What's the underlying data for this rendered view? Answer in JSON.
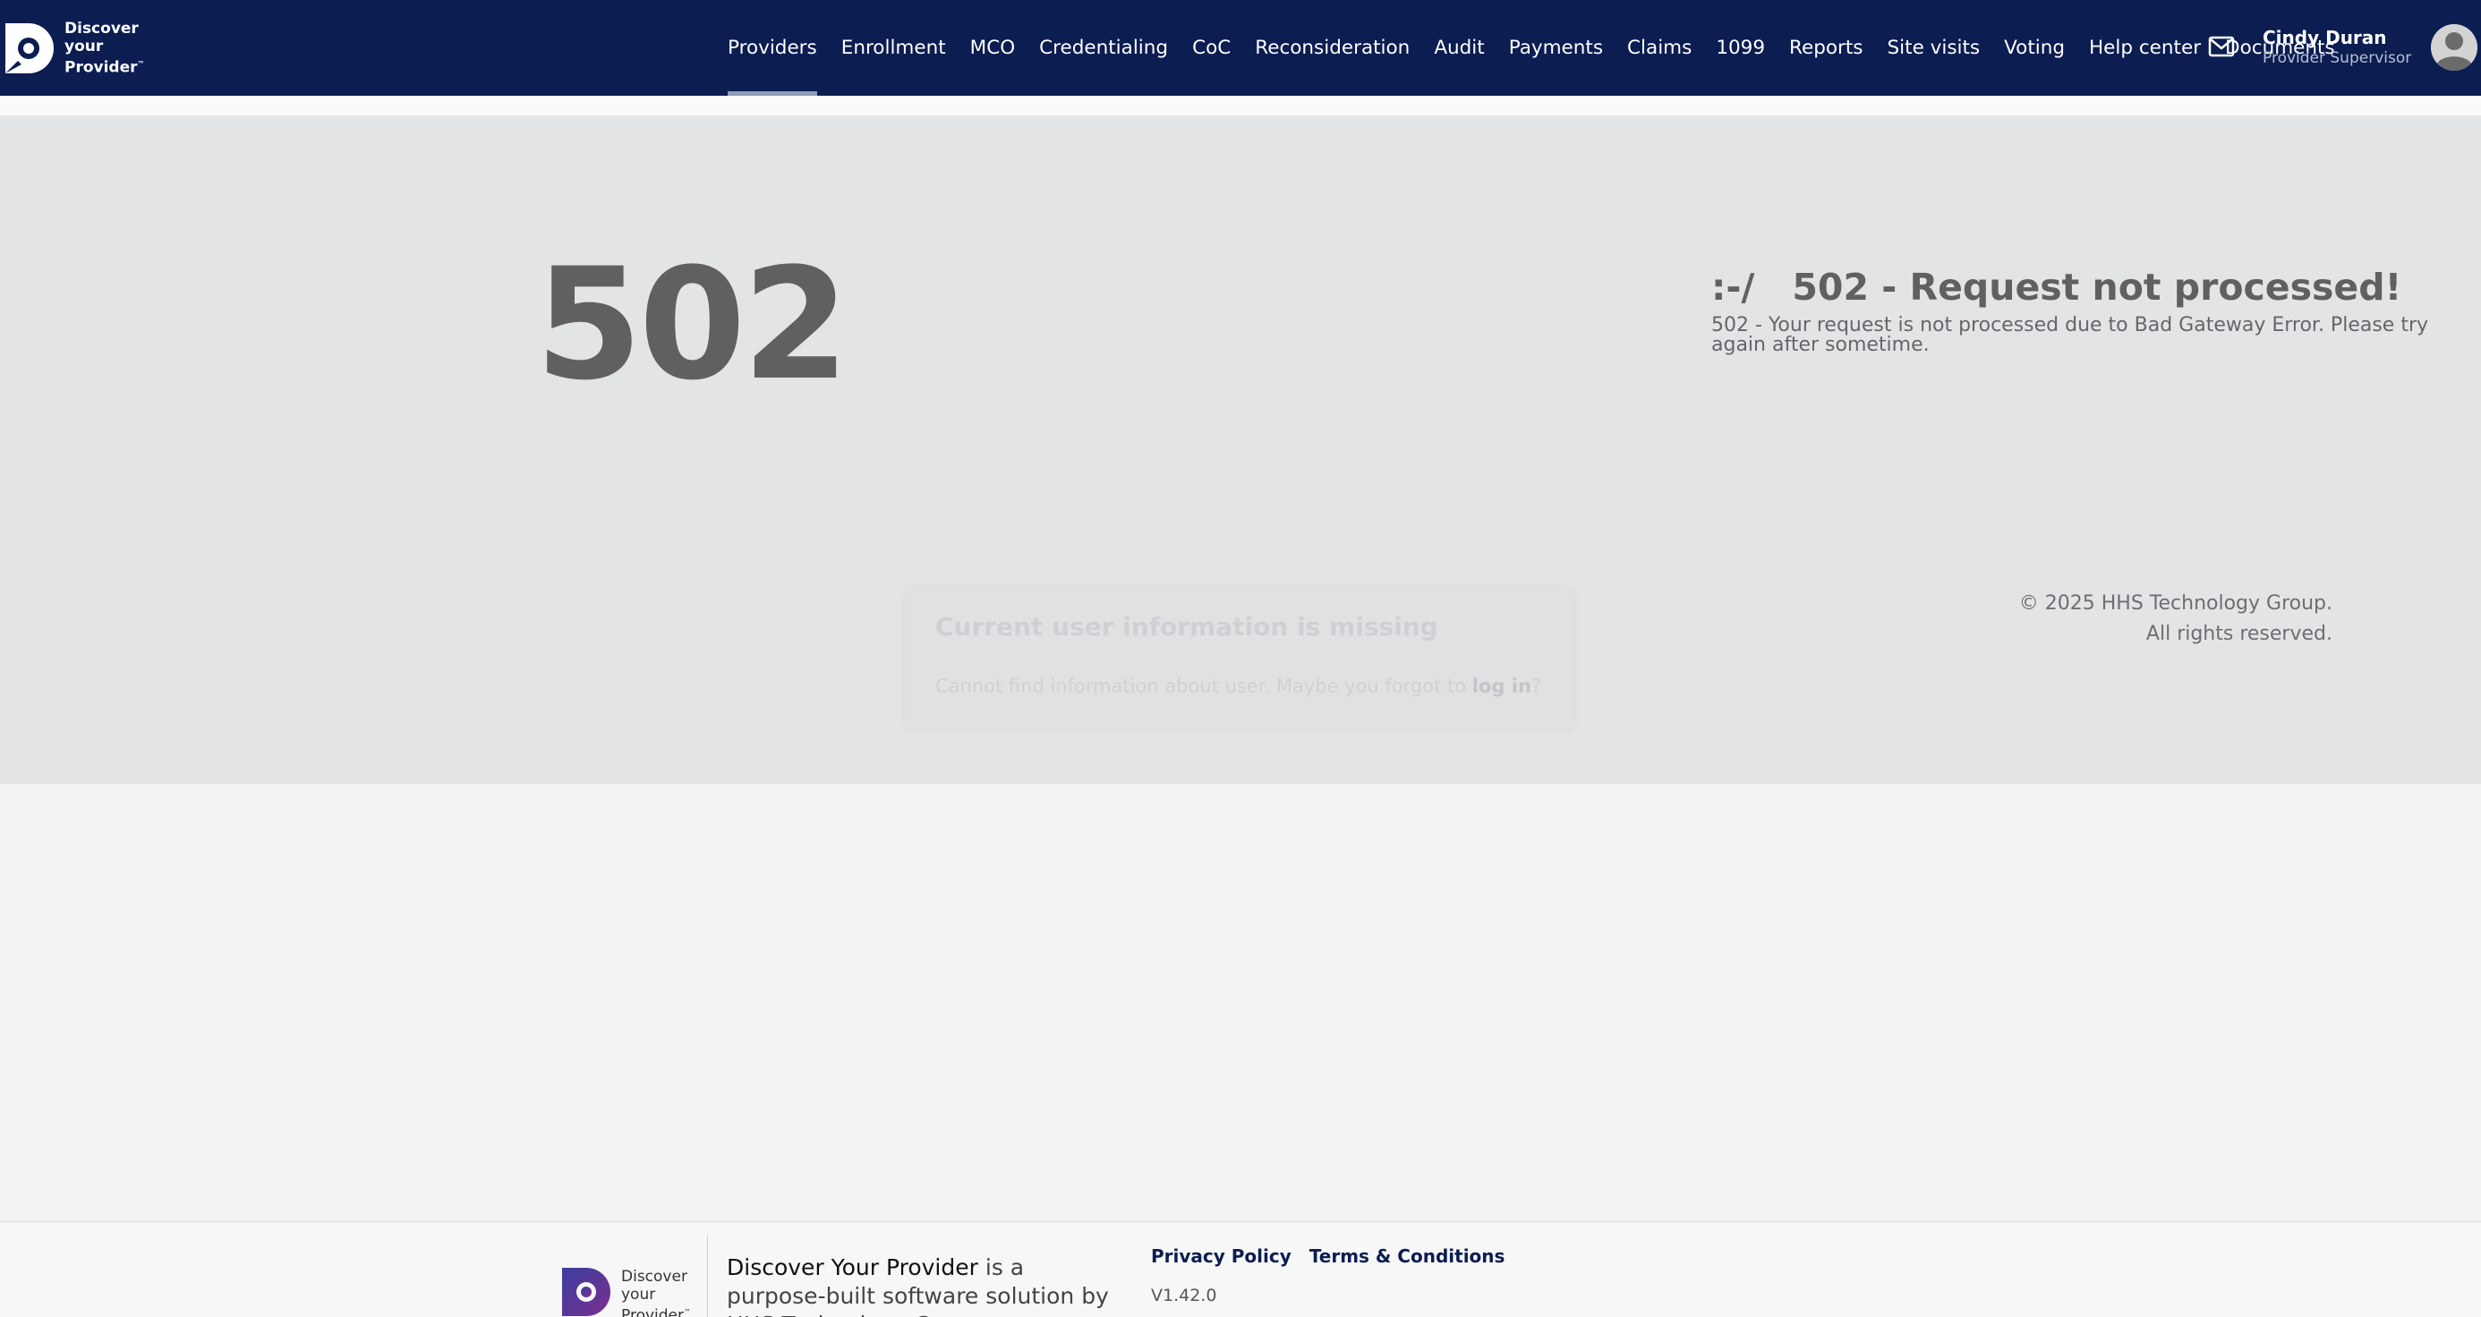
{
  "header": {
    "logo_lines": [
      "Discover",
      "your",
      "Provider"
    ],
    "logo_tm": "™",
    "nav": [
      {
        "label": "Providers",
        "active": true
      },
      {
        "label": "Enrollment"
      },
      {
        "label": "MCO"
      },
      {
        "label": "Credentialing"
      },
      {
        "label": "CoC"
      },
      {
        "label": "Reconsideration"
      },
      {
        "label": "Audit"
      },
      {
        "label": "Payments"
      },
      {
        "label": "Claims"
      },
      {
        "label": "1099"
      },
      {
        "label": "Reports"
      },
      {
        "label": "Site visits"
      },
      {
        "label": "Voting"
      },
      {
        "label": "Help center"
      },
      {
        "label": "Documents"
      }
    ],
    "mail_icon": "mail-icon",
    "user_name": "Cindy Duran",
    "user_role": "Provider Supervisor",
    "avatar_icon": "user-avatar-icon"
  },
  "error": {
    "code": "502",
    "face": ":-/",
    "title": "502 - Request not processed!",
    "message": "502 - Your request is not processed due to Bad Gateway Error. Please try again after sometime."
  },
  "copyright": {
    "line1": "© 2025 HHS Technology Group.",
    "line2": "All rights reserved."
  },
  "toast": {
    "title": "Current user information is missing",
    "body_prefix": "Cannot find information about user. Maybe you forgot to",
    "link": "log in",
    "body_suffix": "?"
  },
  "footer": {
    "logo_lines": [
      "Discover",
      "your",
      "Provider"
    ],
    "logo_tm": "™",
    "brand": "Discover Your Provider",
    "blurb_rest": " is a purpose-built software solution by HHS Technology Group.",
    "privacy": "Privacy Policy",
    "terms": "Terms & Conditions",
    "version": "V1.42.0"
  },
  "colors": {
    "header_bg": "#0b1d51",
    "error_bg": "#e3e4e6",
    "error_text": "#606062"
  }
}
